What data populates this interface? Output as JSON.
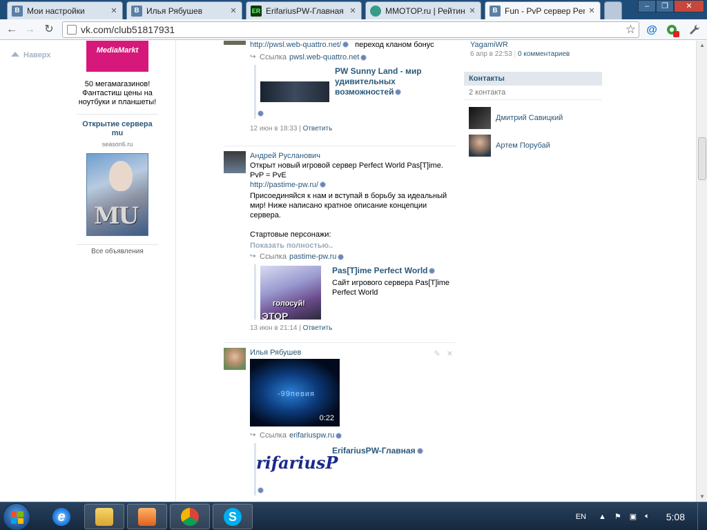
{
  "browser": {
    "tabs": [
      {
        "title": "Мои настройки",
        "favicon": "vk-icon"
      },
      {
        "title": "Илья Рябушев",
        "favicon": "vk-icon"
      },
      {
        "title": "ErifariusPW-Главная",
        "favicon": "er-icon"
      },
      {
        "title": "MMOTOP.ru | Рейтинг с",
        "favicon": "mmotop-icon"
      },
      {
        "title": "Fun - PvP сервер Perfect",
        "favicon": "vk-icon",
        "active": true
      }
    ],
    "url": "vk.com/club51817931"
  },
  "page": {
    "nav_up": "Наверх",
    "ads": {
      "ad1_text": "50 мегамагазинов! Фантастиш цены на ноутбуки и планшеты!",
      "ad1_logo": "MediaMarkt",
      "ad2_title": "Открытие сервера mu",
      "ad2_domain": "season6.ru",
      "ad2_logo": "MU",
      "all_ads": "Все объявления"
    },
    "posts": [
      {
        "link_url": "http://pwsl.web-quattro.net/",
        "text_after": "переход кланом бонус",
        "share_label": "Ссылка",
        "share_domain": "pwsl.web-quattro.net",
        "attach_title": "PW Sunny Land - мир удивительных возможностей",
        "date": "12 июн в 18:33",
        "reply": "Ответить"
      },
      {
        "author": "Андрей Русланович",
        "text1": "Открыт новый игровой сервер Perfect World Pas[T]ime. PvP = PvE",
        "link_url": "http://pastime-pw.ru/",
        "text2": "Присоединяйся к нам и вступай в борьбу за идеальный мир! Ниже написано кратное описание концепции сервера.",
        "text3": "Стартовые персонажи:",
        "show_more": "Показать полностью..",
        "share_label": "Ссылка",
        "share_domain": "pastime-pw.ru",
        "attach_title": "Pas[T]ime Perfect World",
        "attach_desc": "Сайт игрового сервера Pas[T]ime Perfect World",
        "attach_img_text": "голосуй!",
        "attach_img_text2": "ЭТОР",
        "date": "13 июн в 21:14",
        "reply": "Ответить"
      },
      {
        "author": "Илья Рябушев",
        "video_text": "-99певия",
        "video_duration": "0:22",
        "share_label": "Ссылка",
        "share_domain": "erifariuspw.ru",
        "attach_title": "ErifariusPW-Главная",
        "attach_logo": "rifariusP"
      }
    ],
    "right_col": {
      "top_name": "YagamiWR",
      "top_date": "6 апр в 22:53",
      "top_comments": "0 комментариев",
      "contacts_title": "Контакты",
      "contacts_count": "2 контакта",
      "contacts": [
        {
          "name": "Дмитрий Савицкий"
        },
        {
          "name": "Артем Порубай"
        }
      ]
    }
  },
  "taskbar": {
    "lang": "EN",
    "time": "5:08"
  }
}
